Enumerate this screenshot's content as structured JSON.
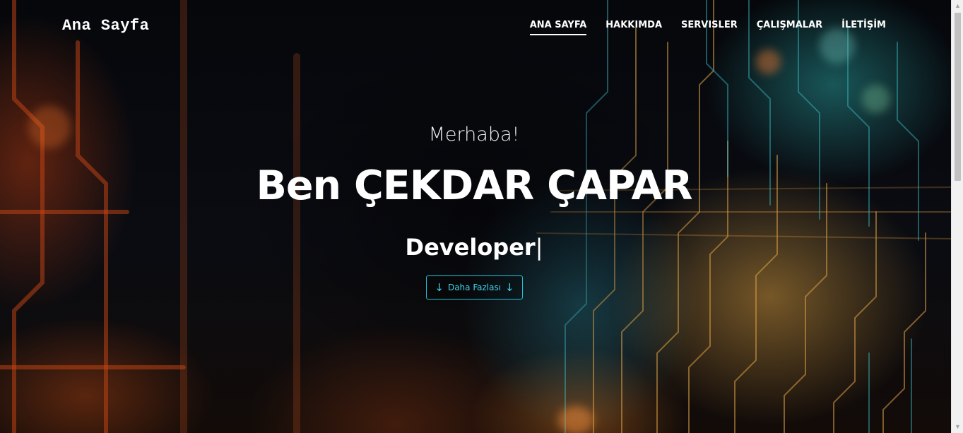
{
  "navbar": {
    "brand": "Ana Sayfa",
    "links": [
      {
        "label": "ANA SAYFA",
        "active": true
      },
      {
        "label": "HAKKIMDA",
        "active": false
      },
      {
        "label": "SERVISLER",
        "active": false
      },
      {
        "label": "ÇALIŞMALAR",
        "active": false
      },
      {
        "label": "İLETİŞİM",
        "active": false
      }
    ]
  },
  "hero": {
    "greeting": "Merhaba!",
    "name": "Ben ÇEKDAR ÇAPAR",
    "role": "Developer",
    "caret": "|",
    "button": {
      "label": "Daha Fazlası",
      "left_icon": "arrow-down-icon",
      "right_icon": "arrow-down-icon"
    }
  },
  "colors": {
    "accent": "#23c3dd",
    "text": "#ffffff",
    "background": "#06080d"
  }
}
